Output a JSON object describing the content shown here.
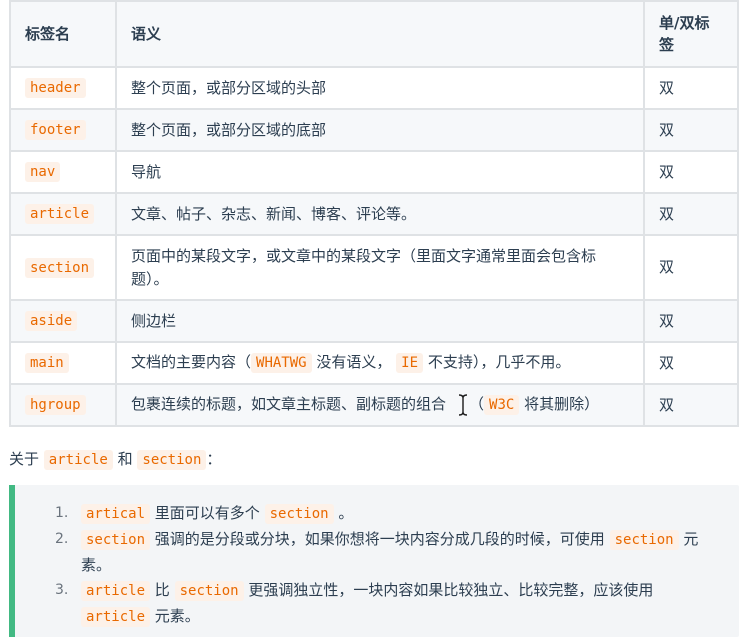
{
  "table": {
    "headers": [
      "标签名",
      "语义",
      "单/双标签"
    ],
    "rows": [
      {
        "tag": "header",
        "meaning": "整个页面，或部分区域的头部",
        "pair": "双"
      },
      {
        "tag": "footer",
        "meaning": "整个页面，或部分区域的底部",
        "pair": "双"
      },
      {
        "tag": "nav",
        "meaning": "导航",
        "pair": "双"
      },
      {
        "tag": "article",
        "meaning": "文章、帖子、杂志、新闻、博客、评论等。",
        "pair": "双"
      },
      {
        "tag": "section",
        "meaning": "页面中的某段文字，或文章中的某段文字（里面文字通常里面会包含标题）。",
        "pair": "双"
      },
      {
        "tag": "aside",
        "meaning": "侧边栏",
        "pair": "双"
      },
      {
        "tag": "main",
        "meaning_parts": [
          "文档的主要内容（",
          "WHATWG",
          "没有语义，",
          "IE",
          "不支持），几乎不用。"
        ],
        "pair": "双"
      },
      {
        "tag": "hgroup",
        "meaning_parts": [
          "包裹连续的标题，如文章主标题、副标题的组合",
          "（",
          "W3C",
          "将其删除）"
        ],
        "pair": "双"
      }
    ]
  },
  "about": {
    "prefix": "关于",
    "code1": "article",
    "mid": "和",
    "code2": "section",
    "suffix": "："
  },
  "tip": {
    "items": [
      {
        "num": "1.",
        "code1": "artical",
        "text1": "里面可以有多个",
        "code2": "section",
        "text2": "。"
      },
      {
        "num": "2.",
        "code1": "section",
        "text1": "强调的是分段或分块，如果你想将一块内容分成几段的时候，可使用",
        "code2": "section",
        "text2": "元素。"
      },
      {
        "num": "3.",
        "code1": "article",
        "text1": "比",
        "code2": "section",
        "text2": "更强调独立性，一块内容如果比较独立、比较完整，应该使用",
        "code3": "article",
        "text3": "元素。"
      }
    ]
  },
  "colors": {
    "code": "#e96900",
    "tip_border": "#42b983",
    "border": "#dfe2e5"
  }
}
